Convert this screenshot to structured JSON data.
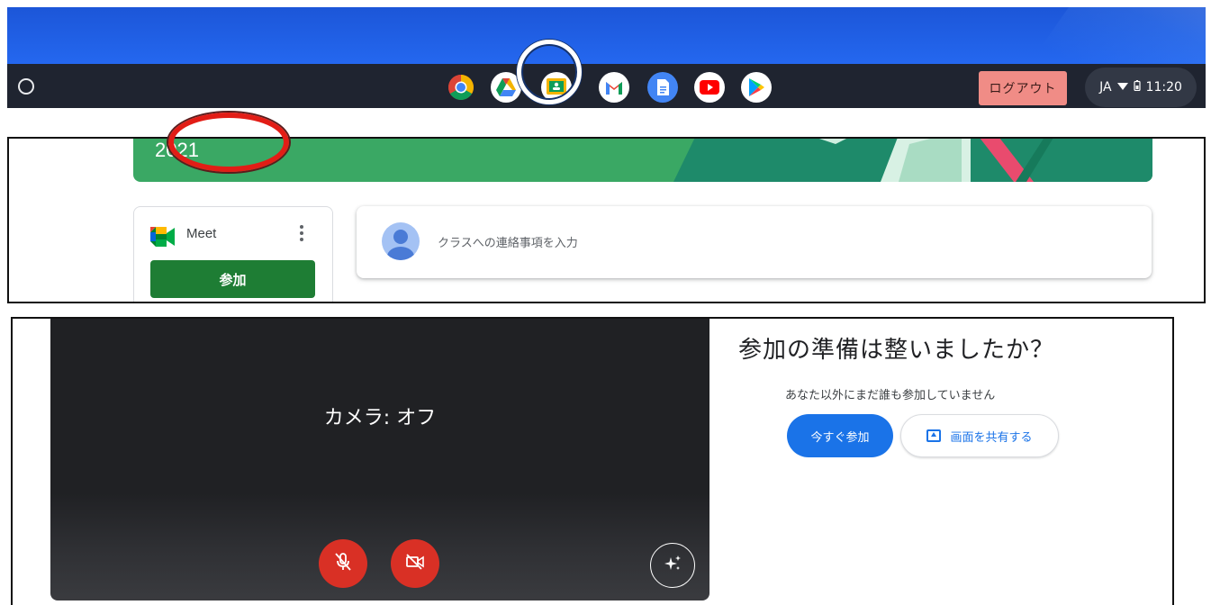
{
  "shelf": {
    "apps": [
      {
        "name": "chrome"
      },
      {
        "name": "google-drive"
      },
      {
        "name": "google-classroom"
      },
      {
        "name": "gmail"
      },
      {
        "name": "google-docs"
      },
      {
        "name": "youtube"
      },
      {
        "name": "google-play"
      }
    ],
    "logout_label": "ログアウト",
    "status": {
      "language": "JA",
      "time": "11:20"
    }
  },
  "classroom": {
    "banner_year": "2021",
    "meet_card": {
      "title": "Meet",
      "join_label": "参加"
    },
    "post_placeholder": "クラスへの連絡事項を入力"
  },
  "meet_prejoin": {
    "camera_status": "カメラ: オフ",
    "ready_title": "参加の準備は整いましたか？",
    "nobody_text": "あなた以外にまだ誰も参加していません",
    "join_now_label": "今すぐ参加",
    "share_screen_label": "画面を共有する"
  },
  "colors": {
    "accent_blue": "#1a73e8",
    "classroom_green": "#1e7d34",
    "control_red": "#d93025",
    "logout_pink": "#f08c86",
    "highlight_red": "#e21d16"
  }
}
